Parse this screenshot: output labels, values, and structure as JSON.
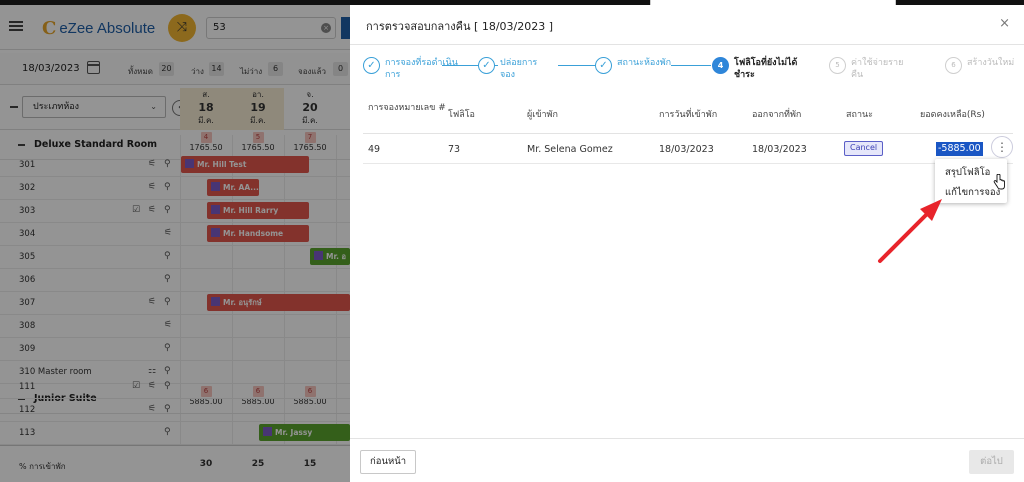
{
  "app": {
    "logo_text": "eZee Absolute",
    "search_value": "53",
    "date": "18/03/2023",
    "stats": [
      {
        "label": "ทั้งหมด",
        "count": "20"
      },
      {
        "label": "ว่าง",
        "count": "14"
      },
      {
        "label": "ไม่ว่าง",
        "count": "6"
      },
      {
        "label": "จองแล้ว",
        "count": "0"
      }
    ],
    "room_type_select": "ประเภทห้อง",
    "days": [
      {
        "dow": "ส.",
        "day": "18",
        "month": "มี.ค."
      },
      {
        "dow": "อา.",
        "day": "19",
        "month": "มี.ค."
      },
      {
        "dow": "จ.",
        "day": "20",
        "month": "มี.ค."
      }
    ],
    "sections": [
      {
        "title": "Deluxe Standard Room",
        "avail": [
          {
            "badge": "4",
            "rate": "1765.50"
          },
          {
            "badge": "5",
            "rate": "1765.50"
          },
          {
            "badge": "7",
            "rate": "1765.50"
          }
        ],
        "rooms": [
          "301",
          "302",
          "303",
          "304",
          "305",
          "306",
          "307",
          "308",
          "309",
          "310 Master room"
        ]
      },
      {
        "title": "Junior Suite",
        "avail": [
          {
            "badge": "6",
            "rate": "5885.00"
          },
          {
            "badge": "6",
            "rate": "5885.00"
          },
          {
            "badge": "6",
            "rate": "5885.00"
          }
        ],
        "rooms": [
          "111",
          "112",
          "113"
        ]
      }
    ],
    "bookings": [
      {
        "name": "Mr. Hill Test"
      },
      {
        "name": "Mr. AA..."
      },
      {
        "name": "Mr. Hill Rarry"
      },
      {
        "name": "Mr. Handsome"
      },
      {
        "name": "Mr. อ"
      },
      {
        "name": "Mr. อนุรักษ์"
      },
      {
        "name": "Mr. Jassy"
      }
    ],
    "footer": {
      "label": "% การเข้าพัก",
      "values": [
        "30",
        "25",
        "15"
      ]
    }
  },
  "modal": {
    "title": "การตรวจสอบกลางคืน [ 18/03/2023 ]",
    "steps": [
      {
        "num": "✓",
        "label": "การจองที่รอดำเนินการ",
        "state": "done"
      },
      {
        "num": "✓",
        "label": "ปล่อยการจอง",
        "state": "done"
      },
      {
        "num": "✓",
        "label": "สถานะห้องพัก",
        "state": "done"
      },
      {
        "num": "4",
        "label": "โฟลิโอที่ยังไม่ได้ชำระ",
        "state": "active"
      },
      {
        "num": "5",
        "label": "ค่าใช้จ่ายรายคืน",
        "state": "todo"
      },
      {
        "num": "6",
        "label": "สร้างวันใหม่",
        "state": "todo"
      }
    ],
    "table": {
      "headers": [
        "การจองหมายเลข #",
        "โฟลิโอ",
        "ผู้เข้าพัก",
        "การวันที่เข้าพัก",
        "ออกจากที่พัก",
        "สถานะ",
        "ยอดคงเหลือ(Rs)"
      ],
      "rows": [
        {
          "reservation": "49",
          "folio": "73",
          "guest": "Mr. Selena Gomez",
          "arrival": "18/03/2023",
          "departure": "18/03/2023",
          "status": "Cancel",
          "balance": "-5885.00"
        }
      ]
    },
    "context_menu": [
      "สรุปโฟลิโอ",
      "แก้ไขการจอง"
    ],
    "buttons": {
      "previous": "ก่อนหน้า",
      "next": "ต่อไป"
    },
    "close": "×"
  },
  "colors": {
    "accent": "#2f86d9",
    "step_done": "#3aa0d8",
    "booking_red": "#e2574c",
    "booking_green": "#5aa42d",
    "annotation_arrow": "#e8242b"
  }
}
